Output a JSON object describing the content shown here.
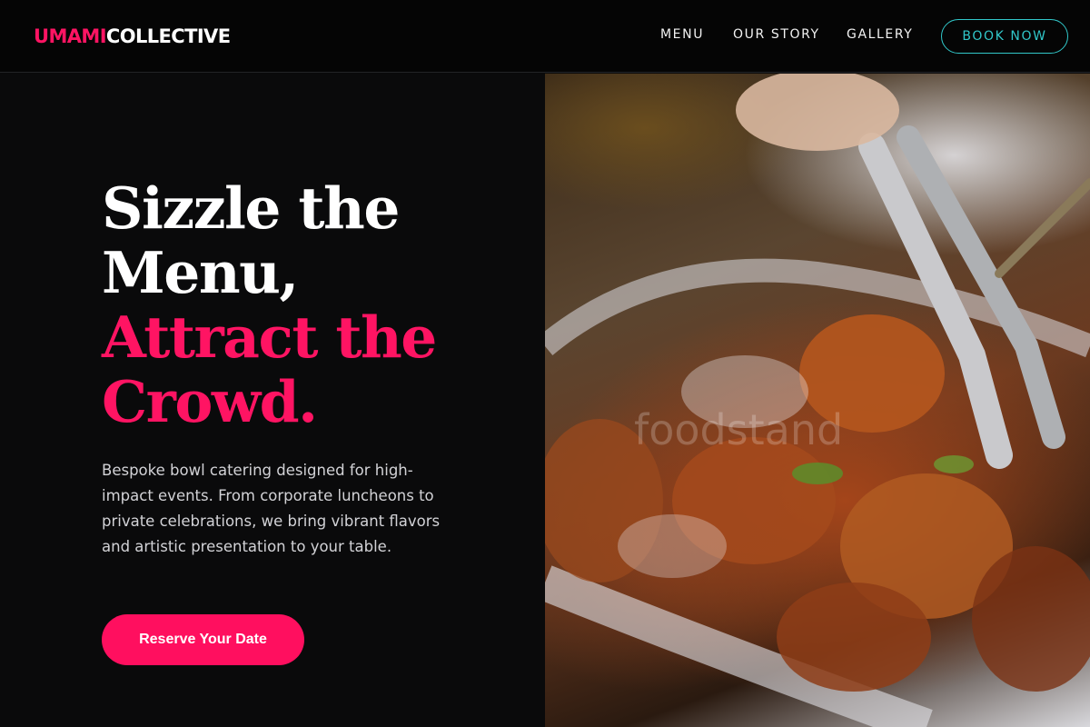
{
  "header": {
    "logo_part1": "UMAMI",
    "logo_part2": "COLLECTIVE",
    "nav": {
      "menu": "MENU",
      "our_story": "OUR STORY",
      "gallery": "GALLERY"
    },
    "book_now": "BOOK NOW"
  },
  "hero": {
    "headline_line1": "Sizzle the",
    "headline_line2": "Menu,",
    "headline_line3": "Attract the",
    "headline_line4": "Crowd.",
    "description": "Bespoke bowl catering designed for high-impact events. From corporate luncheons to private celebrations, we bring vibrant flavors and artistic presentation to your table.",
    "cta": "Reserve Your Date",
    "image_watermark": "foodstand"
  },
  "colors": {
    "background": "#0a0a0b",
    "accent_pink": "#ff1463",
    "accent_teal": "#31c7c9",
    "text_white": "#ffffff",
    "text_muted": "#d2d2d6"
  },
  "icons": {
    "hero_image": "grilled-chicken-bowl-with-tongs-photo"
  }
}
